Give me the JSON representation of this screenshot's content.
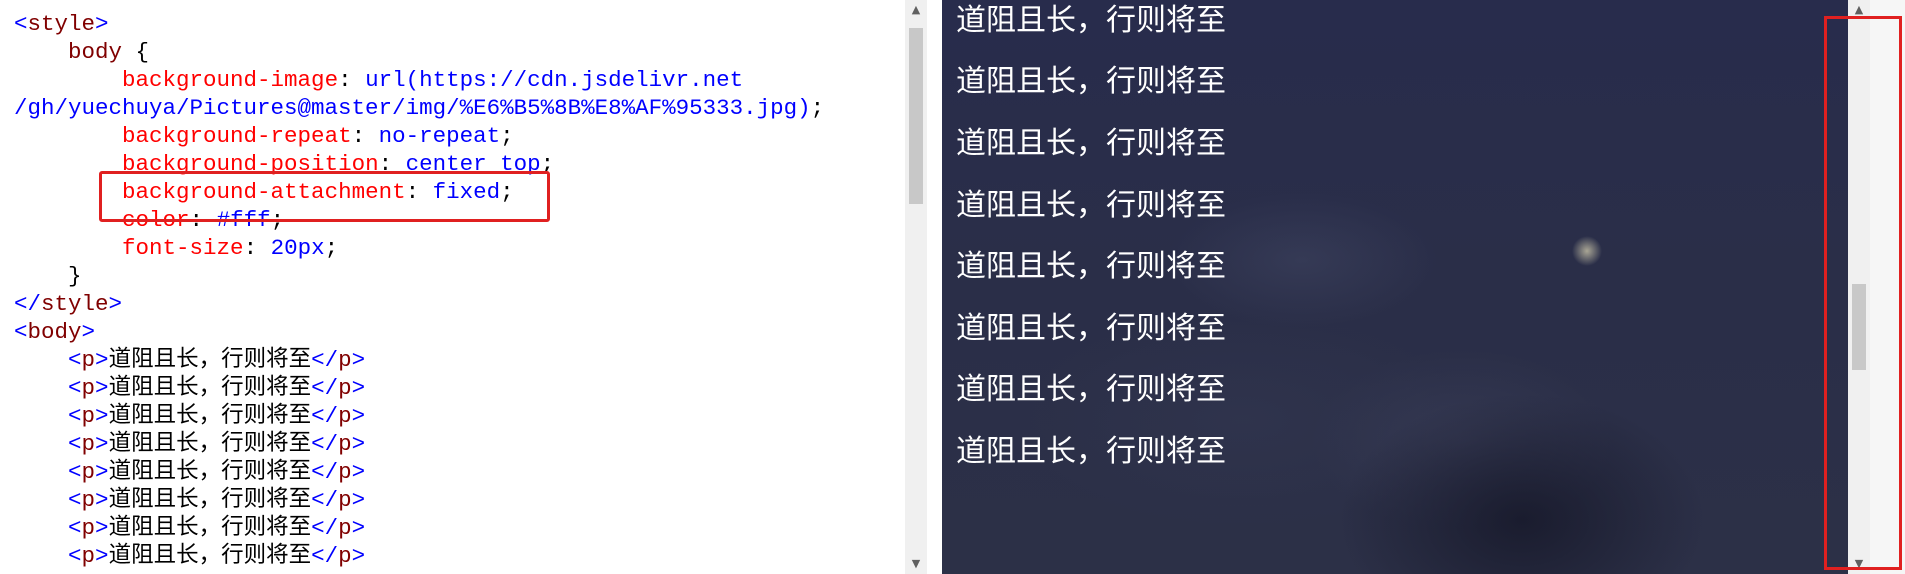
{
  "editor": {
    "lines": [
      [
        {
          "c": "t-br",
          "t": "<"
        },
        {
          "c": "t-tag",
          "t": "style"
        },
        {
          "c": "t-br",
          "t": ">"
        }
      ],
      [
        {
          "c": "t-txt",
          "t": "    "
        },
        {
          "c": "t-sel",
          "t": "body"
        },
        {
          "c": "t-txt",
          "t": " {"
        }
      ],
      [
        {
          "c": "t-txt",
          "t": "        "
        },
        {
          "c": "t-prop",
          "t": "background-image"
        },
        {
          "c": "t-txt",
          "t": ": "
        },
        {
          "c": "t-val",
          "t": "url(https://cdn.jsdelivr.net"
        }
      ],
      [
        {
          "c": "t-val",
          "t": "/gh/yuechuya/Pictures@master/img/%E6%B5%8B%E8%AF%95333.jpg)"
        },
        {
          "c": "t-txt",
          "t": ";"
        }
      ],
      [
        {
          "c": "t-txt",
          "t": "        "
        },
        {
          "c": "t-prop",
          "t": "background-repeat"
        },
        {
          "c": "t-txt",
          "t": ": "
        },
        {
          "c": "t-val",
          "t": "no-repeat"
        },
        {
          "c": "t-txt",
          "t": ";"
        }
      ],
      [
        {
          "c": "t-txt",
          "t": "        "
        },
        {
          "c": "t-prop",
          "t": "background-position"
        },
        {
          "c": "t-txt",
          "t": ": "
        },
        {
          "c": "t-val",
          "t": "center top"
        },
        {
          "c": "t-txt",
          "t": ";"
        }
      ],
      [
        {
          "c": "t-txt",
          "t": "        "
        },
        {
          "c": "t-prop",
          "t": "background-attachment"
        },
        {
          "c": "t-txt",
          "t": ": "
        },
        {
          "c": "t-val",
          "t": "fixed"
        },
        {
          "c": "t-txt",
          "t": ";"
        }
      ],
      [
        {
          "c": "t-txt",
          "t": "        "
        },
        {
          "c": "t-prop",
          "t": "color"
        },
        {
          "c": "t-txt",
          "t": ": "
        },
        {
          "c": "t-val",
          "t": "#fff"
        },
        {
          "c": "t-txt",
          "t": ";"
        }
      ],
      [
        {
          "c": "t-txt",
          "t": "        "
        },
        {
          "c": "t-prop",
          "t": "font-size"
        },
        {
          "c": "t-txt",
          "t": ": "
        },
        {
          "c": "t-val",
          "t": "20px"
        },
        {
          "c": "t-txt",
          "t": ";"
        }
      ],
      [
        {
          "c": "t-txt",
          "t": "    }"
        }
      ],
      [
        {
          "c": "t-br",
          "t": "</"
        },
        {
          "c": "t-tag",
          "t": "style"
        },
        {
          "c": "t-br",
          "t": ">"
        }
      ],
      [
        {
          "c": "t-br",
          "t": "<"
        },
        {
          "c": "t-tag",
          "t": "body"
        },
        {
          "c": "t-br",
          "t": ">"
        }
      ],
      [
        {
          "c": "t-txt",
          "t": "    "
        },
        {
          "c": "t-br",
          "t": "<"
        },
        {
          "c": "t-tag",
          "t": "p"
        },
        {
          "c": "t-br",
          "t": ">"
        },
        {
          "c": "t-txt",
          "t": "道阻且长，行则将至"
        },
        {
          "c": "t-br",
          "t": "</"
        },
        {
          "c": "t-tag",
          "t": "p"
        },
        {
          "c": "t-br",
          "t": ">"
        }
      ],
      [
        {
          "c": "t-txt",
          "t": "    "
        },
        {
          "c": "t-br",
          "t": "<"
        },
        {
          "c": "t-tag",
          "t": "p"
        },
        {
          "c": "t-br",
          "t": ">"
        },
        {
          "c": "t-txt",
          "t": "道阻且长，行则将至"
        },
        {
          "c": "t-br",
          "t": "</"
        },
        {
          "c": "t-tag",
          "t": "p"
        },
        {
          "c": "t-br",
          "t": ">"
        }
      ],
      [
        {
          "c": "t-txt",
          "t": "    "
        },
        {
          "c": "t-br",
          "t": "<"
        },
        {
          "c": "t-tag",
          "t": "p"
        },
        {
          "c": "t-br",
          "t": ">"
        },
        {
          "c": "t-txt",
          "t": "道阻且长，行则将至"
        },
        {
          "c": "t-br",
          "t": "</"
        },
        {
          "c": "t-tag",
          "t": "p"
        },
        {
          "c": "t-br",
          "t": ">"
        }
      ],
      [
        {
          "c": "t-txt",
          "t": "    "
        },
        {
          "c": "t-br",
          "t": "<"
        },
        {
          "c": "t-tag",
          "t": "p"
        },
        {
          "c": "t-br",
          "t": ">"
        },
        {
          "c": "t-txt",
          "t": "道阻且长，行则将至"
        },
        {
          "c": "t-br",
          "t": "</"
        },
        {
          "c": "t-tag",
          "t": "p"
        },
        {
          "c": "t-br",
          "t": ">"
        }
      ],
      [
        {
          "c": "t-txt",
          "t": "    "
        },
        {
          "c": "t-br",
          "t": "<"
        },
        {
          "c": "t-tag",
          "t": "p"
        },
        {
          "c": "t-br",
          "t": ">"
        },
        {
          "c": "t-txt",
          "t": "道阻且长，行则将至"
        },
        {
          "c": "t-br",
          "t": "</"
        },
        {
          "c": "t-tag",
          "t": "p"
        },
        {
          "c": "t-br",
          "t": ">"
        }
      ],
      [
        {
          "c": "t-txt",
          "t": "    "
        },
        {
          "c": "t-br",
          "t": "<"
        },
        {
          "c": "t-tag",
          "t": "p"
        },
        {
          "c": "t-br",
          "t": ">"
        },
        {
          "c": "t-txt",
          "t": "道阻且长，行则将至"
        },
        {
          "c": "t-br",
          "t": "</"
        },
        {
          "c": "t-tag",
          "t": "p"
        },
        {
          "c": "t-br",
          "t": ">"
        }
      ],
      [
        {
          "c": "t-txt",
          "t": "    "
        },
        {
          "c": "t-br",
          "t": "<"
        },
        {
          "c": "t-tag",
          "t": "p"
        },
        {
          "c": "t-br",
          "t": ">"
        },
        {
          "c": "t-txt",
          "t": "道阻且长，行则将至"
        },
        {
          "c": "t-br",
          "t": "</"
        },
        {
          "c": "t-tag",
          "t": "p"
        },
        {
          "c": "t-br",
          "t": ">"
        }
      ],
      [
        {
          "c": "t-txt",
          "t": "    "
        },
        {
          "c": "t-br",
          "t": "<"
        },
        {
          "c": "t-tag",
          "t": "p"
        },
        {
          "c": "t-br",
          "t": ">"
        },
        {
          "c": "t-txt",
          "t": "道阻且长，行则将至"
        },
        {
          "c": "t-br",
          "t": "</"
        },
        {
          "c": "t-tag",
          "t": "p"
        },
        {
          "c": "t-br",
          "t": ">"
        }
      ]
    ],
    "scroll_up_glyph": "▲",
    "scroll_down_glyph": "▼"
  },
  "preview": {
    "paragraphs": [
      "道阻且长，行则将至",
      "道阻且长，行则将至",
      "道阻且长，行则将至",
      "道阻且长，行则将至",
      "道阻且长，行则将至",
      "道阻且长，行则将至",
      "道阻且长，行则将至",
      "道阻且长，行则将至"
    ],
    "text_color": "#ffffff",
    "scroll_up_glyph": "▲",
    "scroll_down_glyph": "▼"
  },
  "colors": {
    "highlight": "#e02020",
    "tag": "#800000",
    "property": "#ff0000",
    "value": "#0000ff",
    "sky": "#282c4c"
  }
}
